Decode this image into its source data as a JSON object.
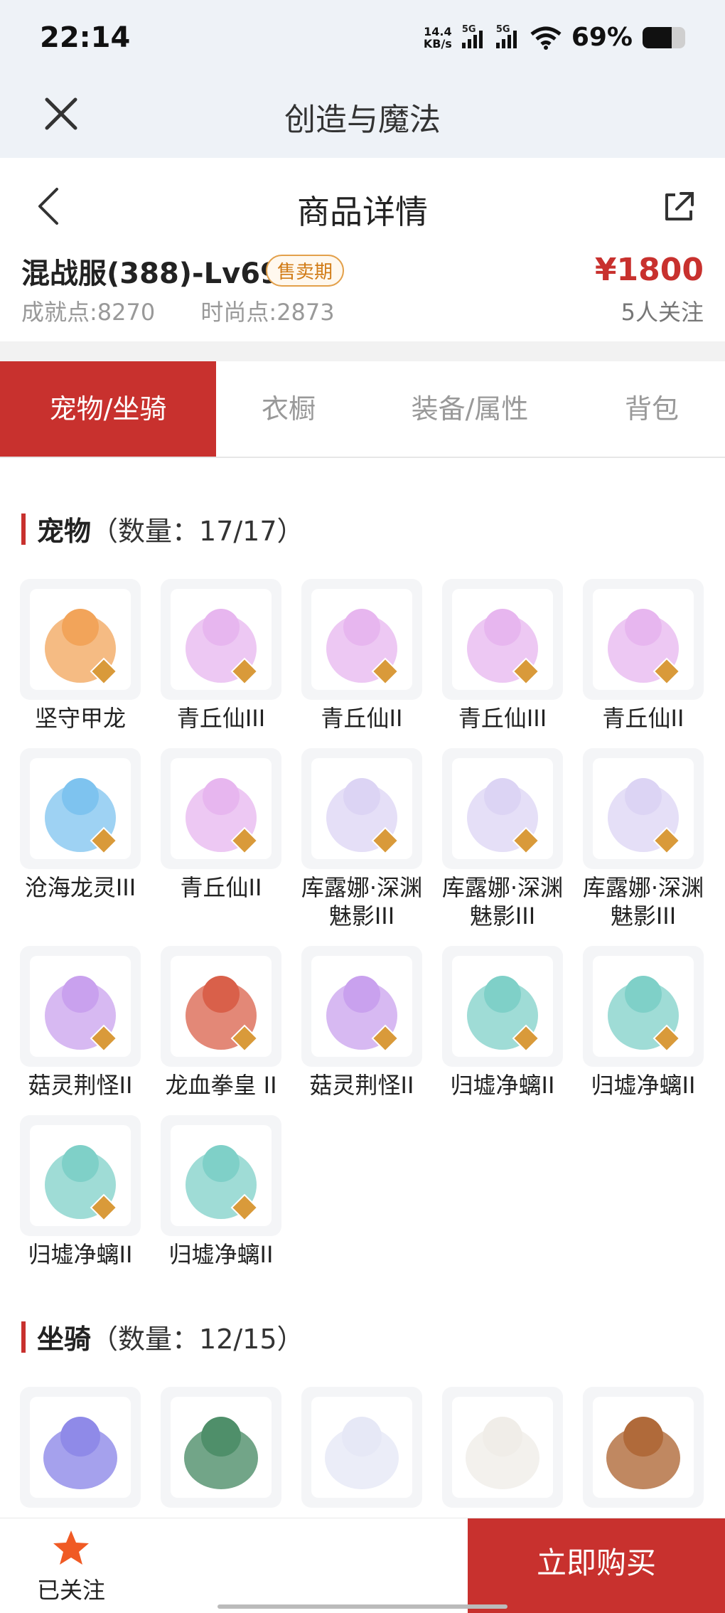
{
  "status_bar": {
    "time": "22:14",
    "net_speed_value": "14.4",
    "net_speed_unit": "KB/s",
    "sim1": "5G",
    "sim2": "5G",
    "battery_pct": "69%",
    "battery_level": 0.69
  },
  "app_bar": {
    "title": "创造与魔法",
    "close_icon": "close-icon"
  },
  "nav_bar": {
    "title": "商品详情",
    "back_icon": "chevron-left-icon",
    "share_icon": "share-icon"
  },
  "product": {
    "name": "混战服(388)-Lv69",
    "badge": "售卖期",
    "achievement": "成就点:8270",
    "fashion": "时尚点:2873",
    "price": "¥1800",
    "followers": "5人关注"
  },
  "tabs": [
    "宠物/坐骑",
    "衣橱",
    "装备/属性",
    "背包"
  ],
  "active_tab": 0,
  "pets": {
    "title": "宠物",
    "count": "（数量：17/17）",
    "items": [
      {
        "name": "坚守甲龙"
      },
      {
        "name": "青丘仙III"
      },
      {
        "name": "青丘仙II"
      },
      {
        "name": "青丘仙III"
      },
      {
        "name": "青丘仙II"
      },
      {
        "name": "沧海龙灵III"
      },
      {
        "name": "青丘仙II"
      },
      {
        "name": "库露娜·深渊魅影III"
      },
      {
        "name": "库露娜·深渊魅影III"
      },
      {
        "name": "库露娜·深渊魅影III"
      },
      {
        "name": "菇灵荆怪II"
      },
      {
        "name": "龙血拳皇 II"
      },
      {
        "name": "菇灵荆怪II"
      },
      {
        "name": "归墟净螭II"
      },
      {
        "name": "归墟净螭II"
      },
      {
        "name": "归墟净螭II"
      },
      {
        "name": "归墟净螭II"
      }
    ]
  },
  "mounts": {
    "title": "坐骑",
    "count": "（数量：12/15）"
  },
  "bottom_bar": {
    "follow_label": "已关注",
    "buy_label": "立即购买",
    "star_color": "#f05a24"
  },
  "colors": {
    "accent": "#c8312e",
    "badge": "#d17b16"
  }
}
